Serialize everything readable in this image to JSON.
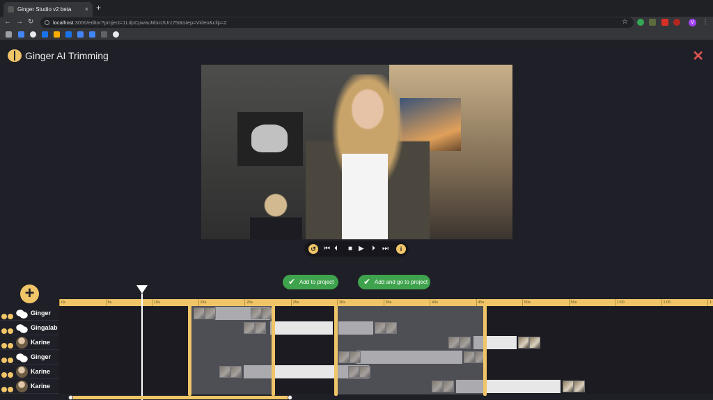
{
  "browser": {
    "tab_title": "Ginger Studio v2 beta",
    "tab_close": "×",
    "new_tab": "+",
    "url_host": "localhost",
    "url_rest": ":3000/editor?project=1LdpCpwauNboIJUrz75I&step=Video&clip=2",
    "back": "←",
    "forward": "→",
    "reload": "↻",
    "star": "☆",
    "menu": "⋮",
    "profile_initial": "V",
    "colors": {
      "extension_green": "#34a853",
      "extension_red": "#d93025",
      "profile": "#a142f4"
    }
  },
  "app": {
    "title": "Ginger AI Trimming",
    "close_icon": "✕",
    "accent": "#f0c568",
    "green": "#3fa34d"
  },
  "controls": {
    "prev_clip": "⏮",
    "step_back": "⏴",
    "stop": "■",
    "play": "▶",
    "step_fwd": "⏵",
    "next_clip": "⏭",
    "loop_icon": "↺",
    "info_icon": "i"
  },
  "actions": {
    "add_to_project": "Add to project",
    "add_and_go": "Add and go to project",
    "check": "✔",
    "add_track": "+"
  },
  "ruler": {
    "ticks": [
      "0s",
      "5s",
      "10s",
      "15s",
      "20s",
      "25s",
      "30s",
      "35s",
      "40s",
      "45s",
      "50s",
      "55s",
      "1:00",
      "1:05",
      "1:10"
    ]
  },
  "tracks": [
    {
      "name": "Ginger",
      "avatar": "chat"
    },
    {
      "name": "Gingalab",
      "avatar": "chat"
    },
    {
      "name": "Karine",
      "avatar": "photo"
    },
    {
      "name": "Ginger",
      "avatar": "chat"
    },
    {
      "name": "Karine",
      "avatar": "photo"
    },
    {
      "name": "Karine",
      "avatar": "photo"
    }
  ]
}
